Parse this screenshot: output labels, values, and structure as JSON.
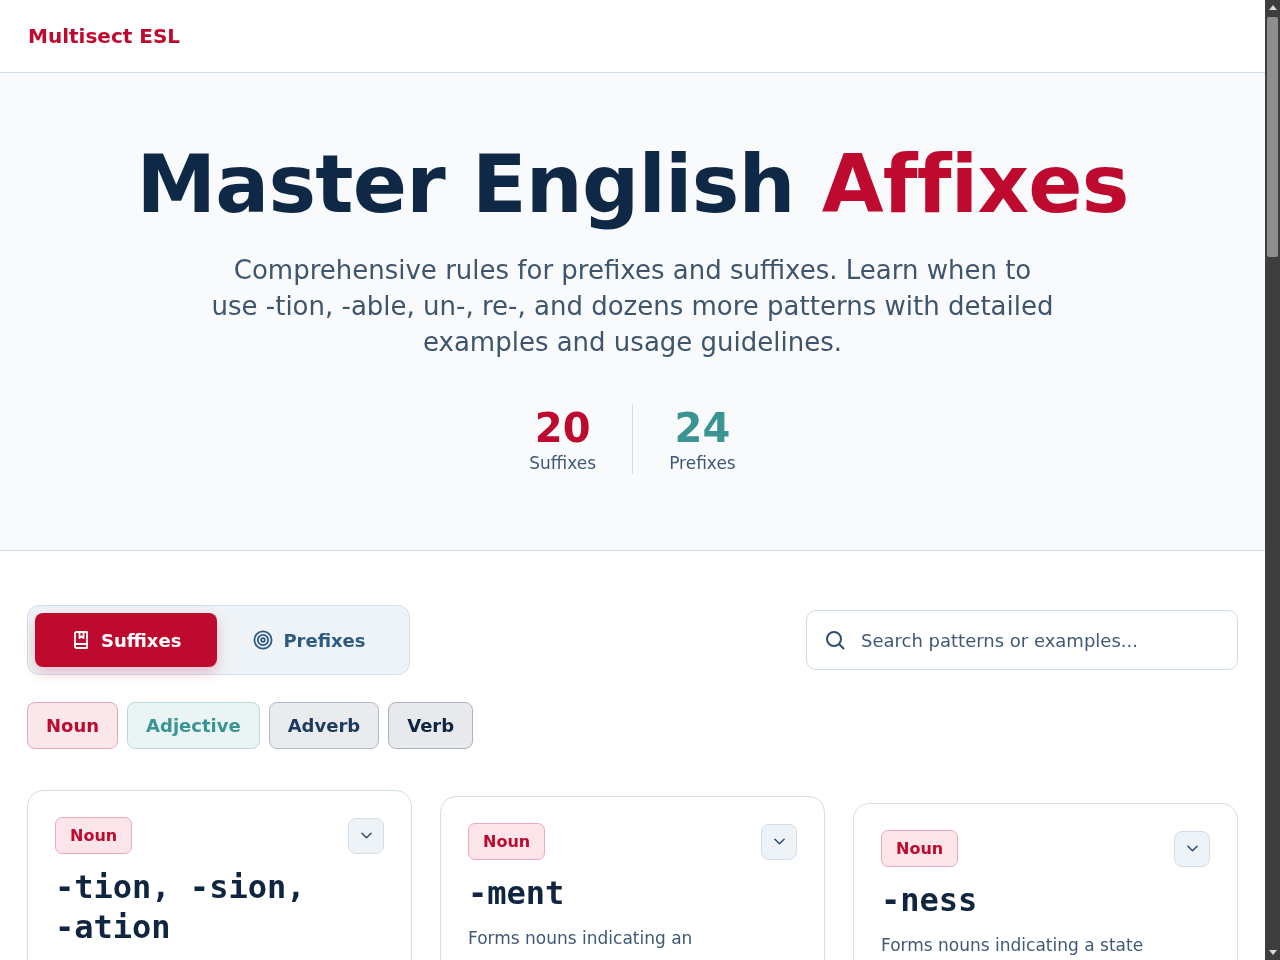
{
  "header": {
    "logo": "Multisect ESL"
  },
  "hero": {
    "title": "Master English",
    "title_highlight": "Affixes",
    "subtitle": "Comprehensive rules for prefixes and suffixes. Learn when to use -tion, -able, un-, re-, and dozens more patterns with detailed examples and usage guidelines.",
    "stats": [
      {
        "value": "20",
        "label": "Suffixes",
        "color": "#be0a2f"
      },
      {
        "value": "24",
        "label": "Prefixes",
        "color": "#3a9494"
      }
    ]
  },
  "tabs": [
    {
      "label": "Suffixes",
      "selected": true
    },
    {
      "label": "Prefixes",
      "selected": false
    }
  ],
  "search": {
    "placeholder": "Search patterns or examples..."
  },
  "filters": [
    {
      "label": "Noun",
      "color": "#be0a2f"
    },
    {
      "label": "Adjective",
      "color": "#3a9494"
    },
    {
      "label": "Adverb",
      "color": "#1e3a5c"
    },
    {
      "label": "Verb",
      "color": "#0f2440"
    }
  ],
  "cards": [
    {
      "badge": "Noun",
      "pattern": "-tion, -sion, -ation",
      "expanded": false
    },
    {
      "badge": "Noun",
      "pattern": "-ment",
      "description": "Forms nouns indicating an",
      "expanded": false
    },
    {
      "badge": "Noun",
      "pattern": "-ness",
      "description": "Forms nouns indicating a state",
      "expanded": false
    }
  ]
}
